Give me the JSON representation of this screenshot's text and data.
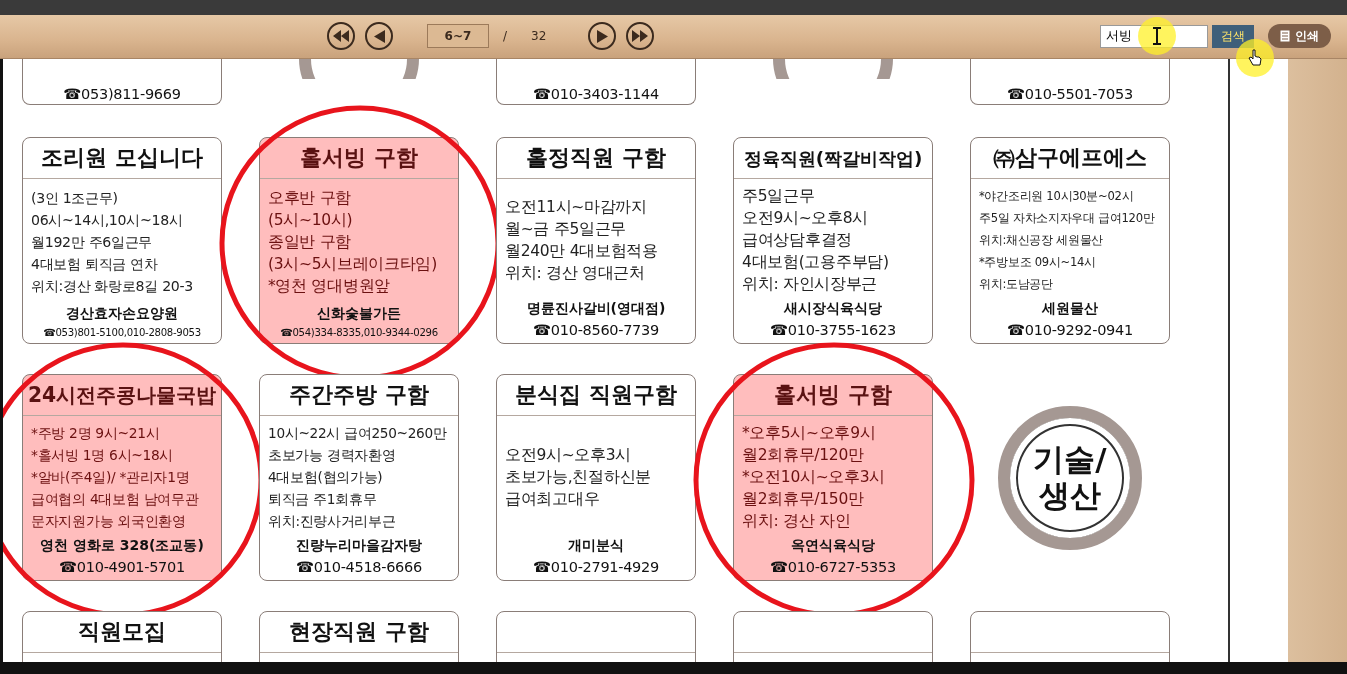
{
  "toolbar": {
    "nav_buttons": [
      {
        "kind": "first"
      },
      {
        "kind": "prev"
      }
    ],
    "page": "6~7",
    "separator": "/",
    "total": "32",
    "nav_buttons_after": [
      {
        "kind": "next"
      },
      {
        "kind": "last"
      }
    ],
    "search": {
      "value": "서빙"
    },
    "search_button": "검색",
    "print_button": "인쇄"
  },
  "top_row": [
    {
      "kind": "card",
      "phone": "☎053)811-9669"
    },
    {
      "kind": "ring"
    },
    {
      "kind": "card",
      "phone": "☎010-3403-1144"
    },
    {
      "kind": "ring"
    },
    {
      "kind": "card",
      "phone": "☎010-5501-7053"
    }
  ],
  "rows": [
    [
      {
        "kind": "card",
        "title": "조리원 모십니다",
        "highlighted": false,
        "circled": false,
        "lines": [
          "(3인 1조근무)",
          "06시~14시,10시~18시",
          "월192만 주6일근무",
          "4대보험 퇴직금 연차",
          "위치:경산 화랑로8길 20-3"
        ],
        "name": "경산효자손요양원",
        "phone": "☎053)801-5100,010-2808-9053"
      },
      {
        "kind": "card",
        "title": "홀서빙 구함",
        "highlighted": true,
        "circled": true,
        "lines": [
          "오후반 구함",
          "(5시~10시)",
          "종일반 구함",
          "(3시~5시브레이크타임)",
          "*영천 영대병원앞"
        ],
        "name": "신화숯불가든",
        "phone": "☎054)334-8335,010-9344-0296"
      },
      {
        "kind": "card",
        "title": "홀정직원 구함",
        "highlighted": false,
        "circled": false,
        "lines": [
          "오전11시~마감까지",
          "월~금 주5일근무",
          "월240만 4대보험적용",
          "위치: 경산 영대근처"
        ],
        "name": "명륜진사갈비(영대점)",
        "phone": "☎010-8560-7739"
      },
      {
        "kind": "card",
        "title": "정육직원(짝갈비작업)",
        "highlighted": false,
        "circled": false,
        "lines": [
          "주5일근무",
          "오전9시~오후8시",
          "급여상담후결정",
          "4대보험(고용주부담)",
          "위치: 자인시장부근"
        ],
        "name": "새시장식육식당",
        "phone": "☎010-3755-1623"
      },
      {
        "kind": "card",
        "title": "㈜삼구에프에스",
        "highlighted": false,
        "circled": false,
        "lines": [
          "*야간조리원 10시30분~02시",
          "주5일 자차소지자우대 급여120만",
          "위치:채신공장 세원물산",
          "*주방보조 09시~14시",
          "위치:도남공단"
        ],
        "name": "세원물산",
        "phone": "☎010-9292-0941"
      }
    ],
    [
      {
        "kind": "card",
        "title": "24시전주콩나물국밥",
        "highlighted": true,
        "circled": true,
        "lines": [
          "*주방 2명 9시~21시",
          "*홀서빙 1명 6시~18시",
          "*알바(주4일)/ *관리자1명",
          "급여협의 4대보험 남여무관",
          "문자지원가능 외국인환영"
        ],
        "name": "영천 영화로 328(조교동)",
        "phone": "☎010-4901-5701"
      },
      {
        "kind": "card",
        "title": "주간주방 구함",
        "highlighted": false,
        "circled": false,
        "lines": [
          "10시~22시 급여250~260만",
          "초보가능 경력자환영",
          "4대보험(협의가능)",
          "퇴직금 주1회휴무",
          "위치:진량사거리부근"
        ],
        "name": "진량누리마을감자탕",
        "phone": "☎010-4518-6666"
      },
      {
        "kind": "card",
        "title": "분식집 직원구함",
        "highlighted": false,
        "circled": false,
        "lines": [
          "오전9시~오후3시",
          "초보가능,친절하신분",
          "급여최고대우"
        ],
        "name": "개미분식",
        "phone": "☎010-2791-4929"
      },
      {
        "kind": "card",
        "title": "홀서빙 구함",
        "highlighted": true,
        "circled": true,
        "lines": [
          "*오후5시~오후9시",
          "월2회휴무/120만",
          "*오전10시~오후3시",
          "월2회휴무/150만",
          "위치: 경산 자인"
        ],
        "name": "옥연식육식당",
        "phone": "☎010-6727-5353"
      },
      {
        "kind": "badge",
        "label": "기술/\n생산"
      }
    ],
    [
      {
        "kind": "card",
        "title": "직원모집",
        "highlighted": false,
        "circled": false
      },
      {
        "kind": "card",
        "title": "현장직원 구함",
        "highlighted": false,
        "circled": false
      },
      {
        "kind": "card",
        "highlighted": false,
        "circled": false
      },
      {
        "kind": "card",
        "highlighted": false,
        "circled": false
      },
      {
        "kind": "card",
        "highlighted": false,
        "circled": false
      }
    ]
  ]
}
